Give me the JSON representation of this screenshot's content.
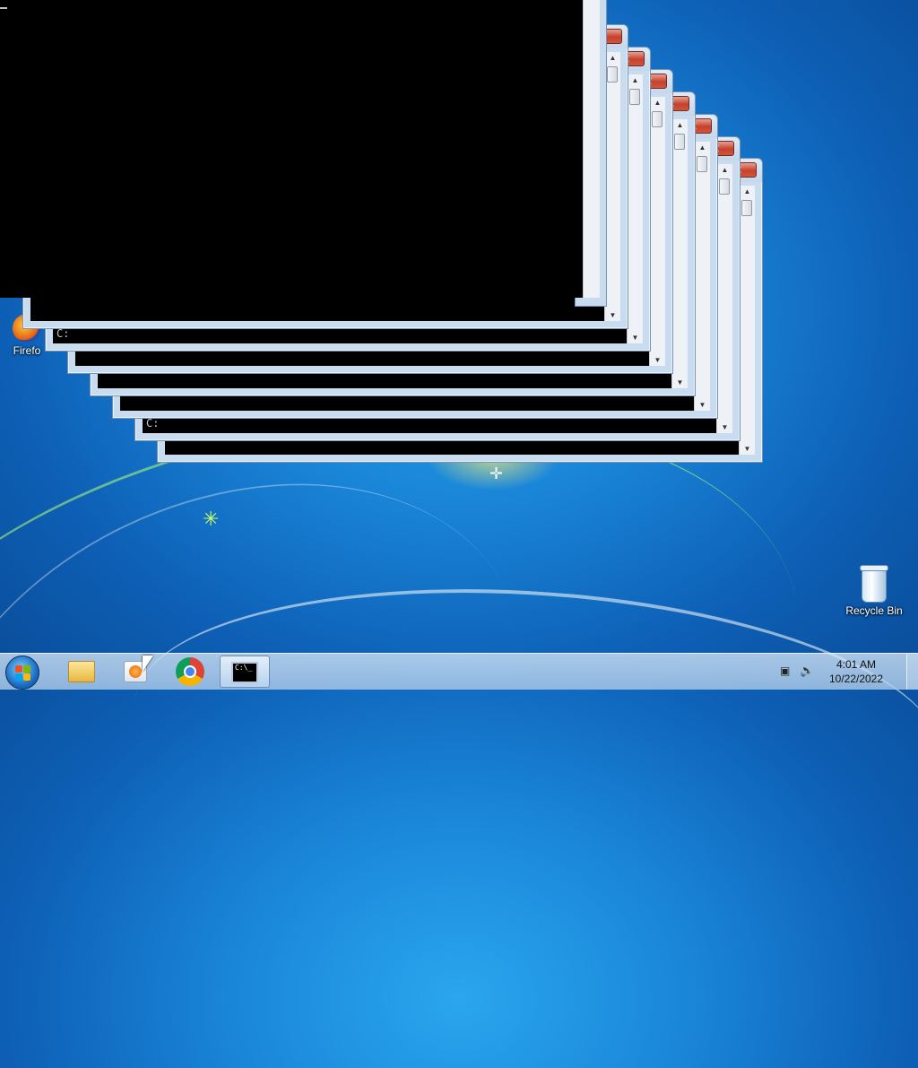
{
  "desktop": {
    "icons": {
      "firefox_label": "Firefo",
      "recycle_bin_label": "Recycle Bin"
    }
  },
  "consoles": {
    "prompt_text": "C:",
    "close_glyph": "✕",
    "restore_glyph": "▭",
    "up_glyph": "▲",
    "down_glyph": "▼"
  },
  "taskbar": {
    "cmd_icon_text": "C:\\_",
    "clock": {
      "time": "4:01 AM",
      "date": "10/22/2022"
    }
  },
  "colors": {
    "close_red": "#c5412c",
    "frame_blue": "#c9dcef",
    "console_black": "#000000"
  }
}
